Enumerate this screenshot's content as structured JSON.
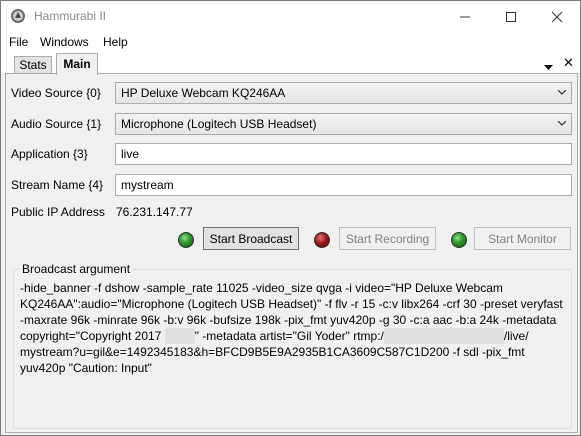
{
  "window": {
    "title": "Hammurabi II"
  },
  "menu": {
    "file": "File",
    "windows": "Windows",
    "help": "Help"
  },
  "tabs": {
    "stats": "Stats",
    "main": "Main",
    "close_glyph": "✕"
  },
  "form": {
    "video_source_label": "Video Source {0}",
    "video_source_value": "HP Deluxe Webcam KQ246AA",
    "audio_source_label": "Audio Source {1}",
    "audio_source_value": "Microphone (Logitech USB Headset)",
    "application_label": "Application {3}",
    "application_value": "live",
    "stream_name_label": "Stream Name {4}",
    "stream_name_value": "mystream",
    "public_ip_label": "Public IP Address",
    "public_ip_value": "76.231.147.77"
  },
  "controls": {
    "start_broadcast": "Start Broadcast",
    "start_recording": "Start Recording",
    "start_monitor": "Start Monitor",
    "broadcast_status": "on",
    "recording_status": "off",
    "monitor_status": "on"
  },
  "colors": {
    "led_on": "#2f9a2f",
    "led_off": "#a01818"
  },
  "broadcast": {
    "title": "Broadcast argument",
    "text_part1": "-hide_banner -f dshow -sample_rate 11025 -video_size qvga -i video=\"HP Deluxe Webcam KQ246AA\":audio=\"Microphone (Logitech USB Headset)\" -f flv -r 15 -c:v libx264 -crf 30 -preset veryfast -maxrate 96k -minrate 96k -b:v 96k -bufsize 198k -pix_fmt yuv420p -g 30 -c:a aac -b:a 24k -metadata copyright=\"Copyright 2017 ",
    "redacted_1": "xxxxx",
    "text_part2": "\" -metadata artist=\"Gil Yoder\" rtmp:/",
    "redacted_2": "xxxxxxxxxxxxxxxxxxxx",
    "text_part3": "/live/ mystream?u=gil&e=1492345183&h=BFCD9B5E9A2935B1CA3609C587C1D200 -f sdl -pix_fmt yuv420p \"Caution: Input\""
  }
}
